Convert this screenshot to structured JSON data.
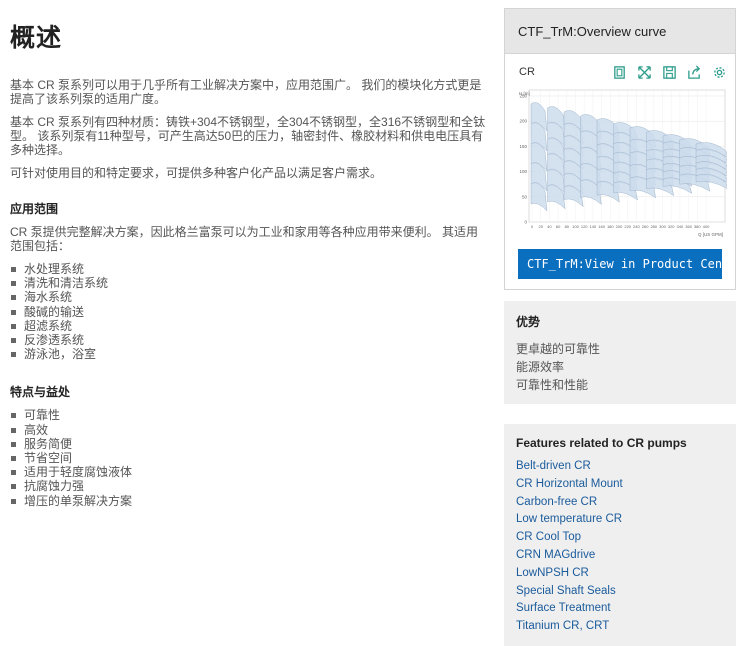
{
  "main": {
    "title": "概述",
    "paragraphs": [
      "基本 CR 泵系列可以用于几乎所有工业解决方案中，应用范围广。 我们的模块化方式更是提高了该系列泵的适用广度。",
      "基本 CR 泵系列有四种材质：铸铁+304不锈钢型，全304不锈钢型，全316不锈钢型和全钛型。 该系列泵有11种型号，可产生高达50巴的压力，轴密封件、橡胶材料和供电电压具有多种选择。",
      "可针对使用目的和特定要求，可提供多种客户化产品以满足客户需求。"
    ],
    "applications": {
      "heading": "应用范围",
      "intro": "CR 泵提供完整解决方案，因此格兰富泵可以为工业和家用等各种应用带来便利。 其适用范围包括：",
      "items": [
        "水处理系统",
        "清洗和清洁系统",
        "海水系统",
        "酸碱的输送",
        "超滤系统",
        "反渗透系统",
        "游泳池，浴室"
      ]
    },
    "features": {
      "heading": "特点与益处",
      "items": [
        "可靠性",
        "高效",
        "服务简便",
        "节省空间",
        "适用于轻度腐蚀液体",
        "抗腐蚀力强",
        "增压的单泵解决方案"
      ]
    }
  },
  "curve_widget": {
    "title": "CTF_TrM:Overview curve",
    "product": "CR",
    "icons": [
      "fit-screen-icon",
      "expand-icon",
      "save-icon",
      "share-icon",
      "settings-icon"
    ],
    "y_axis_label": "H [m]",
    "y_ticks": [
      "250",
      "200",
      "150",
      "100",
      "50",
      "0"
    ],
    "x_ticks": [
      "0",
      "20",
      "40",
      "60",
      "80",
      "100",
      "120",
      "140",
      "160",
      "180",
      "200",
      "220",
      "240",
      "260",
      "280",
      "300",
      "320",
      "340",
      "360",
      "380",
      "400"
    ],
    "x_unit": "Q [US GPM]",
    "cta_label": "CTF_TrM:View in Product Center",
    "accent": "#0b6fc0",
    "region_fill": "#cddcec",
    "region_stroke": "#9ab0c8"
  },
  "advantages": {
    "heading": "优势",
    "items": [
      "更卓越的可靠性",
      "能源效率",
      "可靠性和性能"
    ]
  },
  "related": {
    "heading": "Features related to CR pumps",
    "links": [
      "Belt-driven CR",
      "CR Horizontal Mount",
      "Carbon-free CR",
      "Low temperature CR",
      "CR Cool Top",
      "CRN MAGdrive",
      "LowNPSH CR",
      "Special Shaft Seals",
      "Surface Treatment",
      "Titanium CR, CRT"
    ],
    "link_color": "#1a5b9c"
  }
}
